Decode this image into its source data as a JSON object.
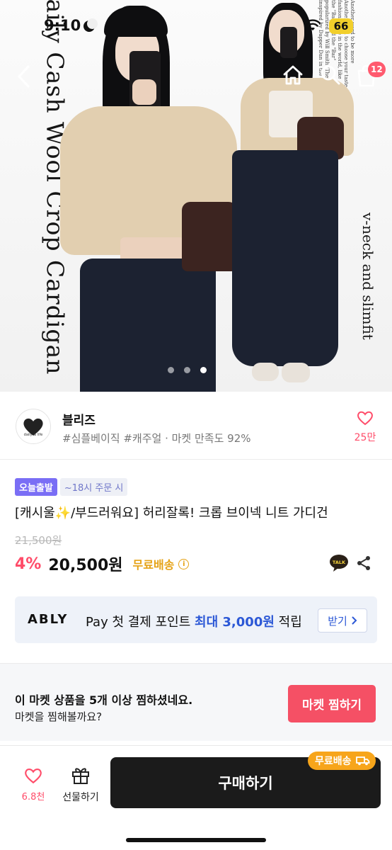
{
  "status_bar": {
    "time": "9:10",
    "battery": "66"
  },
  "hero": {
    "text_left": "Daily Cash Wool Crop Cardigan",
    "text_right": "v-neck and slimfit",
    "fine_print": "Another word to be more\nAnother word to choose your taste\nfashion house in the world, like\nthe \"Bar\", and the \"Bar\"\npopularized by Will Smith (The Fresh Prince) and C.\ninspired by Dapper Dan in the early 1980s, was the adaptation and branding of big",
    "slide_count": 3,
    "active_slide": 3
  },
  "nav": {
    "cart_count": "12"
  },
  "store": {
    "name": "블리즈",
    "tags": "#심플베이직 #캐주얼 · 마켓 만족도 92%",
    "likes": "25만",
    "logo_text": "daily & life"
  },
  "product": {
    "badge_today": "오늘출발",
    "badge_time": "~18시 주문 시",
    "title": "[캐시울✨/부드러워요] 허리잘록! 크롭 브이넥 니트 가디건",
    "original_price": "21,500원",
    "discount": "4%",
    "price": "20,500원",
    "free_shipping": "무료배송"
  },
  "pay_banner": {
    "brand": "ABLY",
    "brand_pay": "Pay",
    "text_before": "첫 결제 포인트",
    "highlight": "최대 3,000원",
    "text_after": "적립",
    "button": "받기"
  },
  "market_prompt": {
    "line1": "이 마켓 상품을 5개 이상 찜하셨네요.",
    "line2": "마켓을 찜해볼까요?",
    "button": "마켓 찜하기"
  },
  "bottom_bar": {
    "likes": "6.8천",
    "gift_label": "선물하기",
    "buy_label": "구매하기",
    "ship_tag": "무료배송"
  },
  "colors": {
    "accent_pink": "#ff4d6a",
    "badge_purple": "#7a6ef5",
    "ship_orange": "#e5a215",
    "pay_blue": "#2c58d6",
    "fav_button": "#f55065"
  }
}
